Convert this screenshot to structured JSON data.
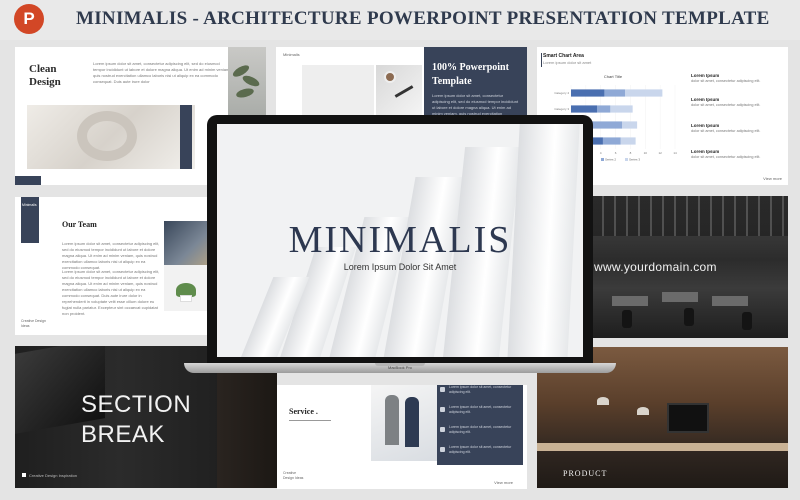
{
  "header": {
    "title": "MINIMALIS - ARCHITECTURE POWERPOINT PRESENTATION TEMPLATE",
    "app_icon": "powerpoint-icon",
    "app_icon_letter": "P",
    "app_color": "#d24726"
  },
  "slides": {
    "clean_design": {
      "title_line1": "Clean",
      "title_line2": "Design",
      "body": "Lorem ipsum dolor sit amet, consectetur adipiscing elit, sed do eiusmod tempor incididunt ut labore et dolore magna aliqua. Ut enim ad minim veniam, quis nostrud exercitation ullamco laboris nisi ut aliquip ex ea commodo consequat. Duis aute irure dolor"
    },
    "powerpoint_template": {
      "label": "Minimalis",
      "title_line1": "100% Powerpoint",
      "title_line2": "Template",
      "body": "Lorem ipsum dolor sit amet, consectetur adipiscing elit, sed do eiusmod tempor incididunt ut labore et dolore magna aliqua. Ut enim ad minim veniam, quis nostrud exercitation"
    },
    "smart_chart": {
      "title": "Smart Chart Area",
      "subtitle": "Lorem ipsum dolor sit amet",
      "labels": [
        {
          "head": "Lorem Ipsum",
          "desc": "dolor sit amet, consectetur adipiscing elit."
        },
        {
          "head": "Lorem Ipsum",
          "desc": "dolor sit amet, consectetur adipiscing elit."
        },
        {
          "head": "Lorem Ipsum",
          "desc": "dolor sit amet, consectetur adipiscing elit."
        },
        {
          "head": "Lorem Ipsum",
          "desc": "dolor sit amet, consectetur adipiscing elit."
        }
      ],
      "view_more": "View more"
    },
    "our_team": {
      "label": "Minimalis",
      "title": "Our Team",
      "body1": "Lorem ipsum dolor sit amet, consectetur adipiscing elit, sed do eiusmod tempor incididunt ut labore et dolore magna aliqua. Ut enim ad minim veniam, quis nostrud exercitation ullamco laboris nisi ut aliquip ex ea commodo consequat.",
      "body2": "Lorem ipsum dolor sit amet, consectetur adipiscing elit, sed do eiusmod tempor incididunt ut labore et dolore magna aliqua. Ut enim ad minim veniam, quis nostrud exercitation ullamco laboris nisi ut aliquip ex ea commodo consequat. Duis aute irure dolor in reprehenderit in voluptate velit esse cillum dolore eu fugiat nulla pariatur. Excepteur sint occaecat cupidatat non proident.",
      "footer": "Creative Design Ideas"
    },
    "domain": {
      "text": "www.yourdomain.com"
    },
    "section_break": {
      "line1": "SECTION",
      "line2": "BREAK",
      "footer": "Creative Design Inspiration"
    },
    "service": {
      "title": "Service .",
      "footer": "Creative Design Ideas",
      "items": [
        "Lorem ipsum dolor sit amet, consectetur adipiscing elit.",
        "Lorem ipsum dolor sit amet, consectetur adipiscing elit.",
        "Lorem ipsum dolor sit amet, consectetur adipiscing elit.",
        "Lorem ipsum dolor sit amet, consectetur adipiscing elit."
      ],
      "view_more": "View more"
    },
    "product": {
      "title": "PRODUCT"
    }
  },
  "laptop": {
    "title": "MINIMALIS",
    "subtitle": "Lorem Ipsum Dolor Sit Amet",
    "model": "MacBook Pro"
  },
  "colors": {
    "navy": "#384359",
    "dark_title": "#2f3a4d"
  },
  "chart_data": {
    "type": "bar",
    "orientation": "horizontal",
    "title": "Chart Title",
    "categories": [
      "Category 4",
      "Category 3",
      "Category 2",
      "Category 1"
    ],
    "series": [
      {
        "name": "Series 1",
        "values": [
          4.5,
          3.5,
          2.5,
          4.3
        ],
        "color": "#4a6fb0"
      },
      {
        "name": "Series 2",
        "values": [
          2.8,
          1.8,
          4.4,
          2.4
        ],
        "color": "#8fa9d6"
      },
      {
        "name": "Series 3",
        "values": [
          5.0,
          3.0,
          2.0,
          2.0
        ],
        "color": "#c9d6ec"
      }
    ],
    "x_ticks": [
      "0",
      "2",
      "4",
      "6",
      "8",
      "10",
      "12",
      "14"
    ],
    "xlim": [
      0,
      14
    ],
    "stacked": true,
    "legend": "bottom"
  }
}
